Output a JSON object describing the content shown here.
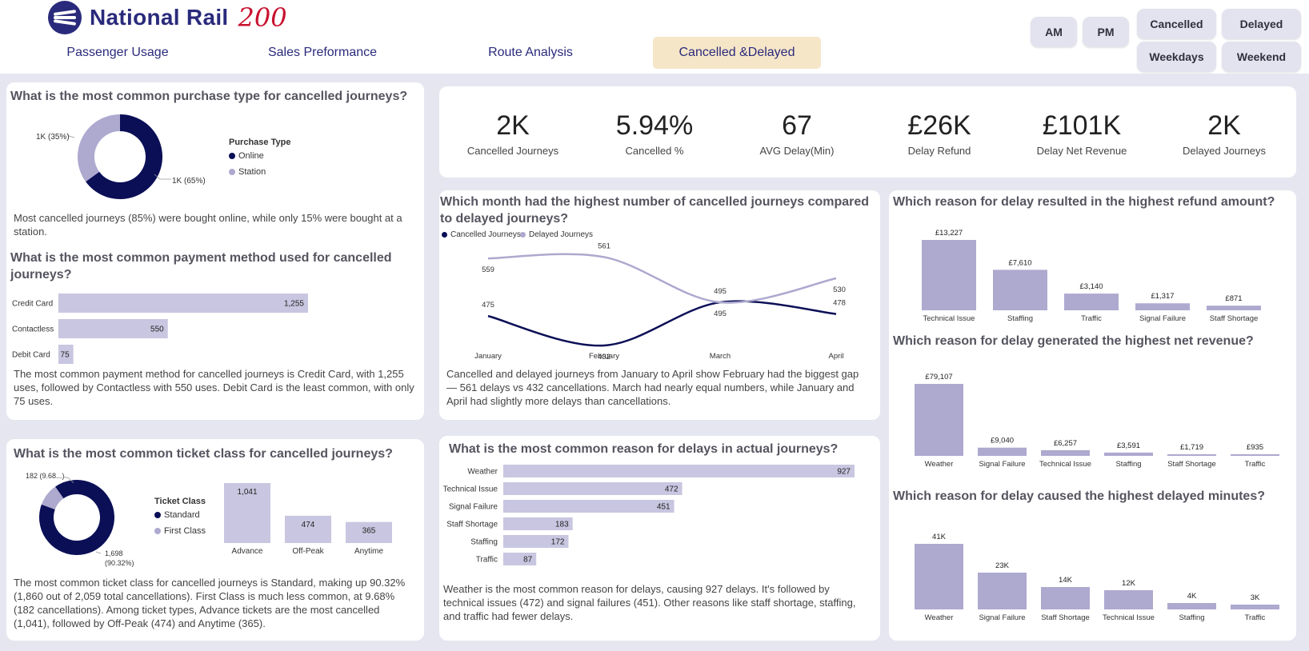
{
  "colors": {
    "navy": "#0a0f56",
    "lavender": "#ada9cf",
    "bar": "#c8c6e0",
    "active_tab": "#f6e6c8"
  },
  "brand": {
    "name": "National Rail",
    "badge": "200"
  },
  "nav": {
    "tabs": [
      "Passenger Usage",
      "Sales Preformance",
      "Route Analysis",
      "Cancelled &Delayed"
    ],
    "active": "Cancelled &Delayed"
  },
  "slicers": {
    "am": "AM",
    "pm": "PM",
    "cancelled": "Cancelled",
    "delayed": "Delayed",
    "weekdays": "Weekdays",
    "weekend": "Weekend"
  },
  "kpis": [
    {
      "value": "2K",
      "label": "Cancelled Journeys"
    },
    {
      "value": "5.94%",
      "label": "Cancelled %"
    },
    {
      "value": "67",
      "label": "AVG Delay(Min)"
    },
    {
      "value": "£26K",
      "label": "Delay Refund"
    },
    {
      "value": "£101K",
      "label": "Delay Net Revenue"
    },
    {
      "value": "2K",
      "label": "Delayed Journeys"
    }
  ],
  "purchase": {
    "question": "What is the most common purchase type for cancelled journeys?",
    "legend_title": "Purchase Type",
    "legend": [
      "Online",
      "Station"
    ],
    "label_online": "1K (65%)",
    "label_station": "1K (35%)",
    "text": "Most cancelled journeys (85%) were bought online, while only 15% were bought at a station."
  },
  "payment": {
    "question": "What is the most common payment method used for cancelled journeys?",
    "text": "The most common payment method for cancelled journeys is Credit Card, with 1,255 uses, followed by Contactless with 550 uses. Debit Card is the least common, with only 75 uses."
  },
  "ticket": {
    "question": "What is the most common ticket class for cancelled journeys?",
    "legend_title": "Ticket Class",
    "legend": [
      "Standard",
      "First Class"
    ],
    "label_first": "182 (9.68...)",
    "label_standard_1": "1,698",
    "label_standard_2": "(90.32%)",
    "text": "The most common ticket class for cancelled journeys is Standard, making up 90.32% (1,860 out of 2,059 total cancellations). First Class is much less common, at 9.68% (182 cancellations). Among ticket types, Advance tickets are the most cancelled (1,041), followed by Off-Peak (474) and Anytime (365)."
  },
  "month": {
    "question": "Which month had the highest number of cancelled journeys compared to delayed journeys?",
    "text": "Cancelled and delayed journeys from January to April show February had the biggest gap — 561 delays vs 432 cancellations. March had nearly equal numbers, while January and April had slightly more delays than cancellations."
  },
  "reasons": {
    "question": "What is the most common reason for delays in actual journeys?",
    "text": "Weather is the most common reason for delays, causing 927 delays. It's followed by technical issues (472) and signal failures (451). Other reasons like staff shortage, staffing, and traffic had fewer delays."
  },
  "refund": {
    "question": "Which reason for delay resulted in the highest refund amount?"
  },
  "revenue": {
    "question": "Which reason for delay generated the highest net revenue?"
  },
  "minutes": {
    "question": "Which reason for delay caused the highest delayed minutes?"
  },
  "chart_data": [
    {
      "id": "purchase",
      "type": "pie",
      "categories": [
        "Online",
        "Station"
      ],
      "values": [
        65,
        35
      ],
      "labels": [
        "1K (65%)",
        "1K (35%)"
      ]
    },
    {
      "id": "payment",
      "type": "bar",
      "orientation": "horizontal",
      "categories": [
        "Credit Card",
        "Contactless",
        "Debit Card"
      ],
      "values": [
        1255,
        550,
        75
      ],
      "labels": [
        "1,255",
        "550",
        "75"
      ]
    },
    {
      "id": "ticket_class",
      "type": "pie",
      "categories": [
        "Standard",
        "First Class"
      ],
      "values": [
        90.32,
        9.68
      ]
    },
    {
      "id": "ticket_type",
      "type": "bar",
      "categories": [
        "Advance",
        "Off-Peak",
        "Anytime"
      ],
      "values": [
        1041,
        474,
        365
      ],
      "labels": [
        "1,041",
        "474",
        "365"
      ]
    },
    {
      "id": "month",
      "type": "line",
      "x": [
        "January",
        "February",
        "March",
        "April"
      ],
      "legend": [
        "Cancelled Journeys",
        "Delayed Journeys"
      ],
      "series": [
        {
          "name": "Cancelled Journeys",
          "values": [
            475,
            432,
            495,
            478
          ]
        },
        {
          "name": "Delayed Journeys",
          "values": [
            559,
            561,
            495,
            530
          ]
        }
      ]
    },
    {
      "id": "reasons",
      "type": "bar",
      "orientation": "horizontal",
      "categories": [
        "Weather",
        "Technical Issue",
        "Signal Failure",
        "Staff Shortage",
        "Staffing",
        "Traffic"
      ],
      "values": [
        927,
        472,
        451,
        183,
        172,
        87
      ]
    },
    {
      "id": "refund",
      "type": "bar",
      "categories": [
        "Technical Issue",
        "Staffing",
        "Traffic",
        "Signal Failure",
        "Staff Shortage"
      ],
      "values": [
        13227,
        7610,
        3140,
        1317,
        871
      ],
      "labels": [
        "£13,227",
        "£7,610",
        "£3,140",
        "£1,317",
        "£871"
      ]
    },
    {
      "id": "revenue",
      "type": "bar",
      "categories": [
        "Weather",
        "Signal Failure",
        "Technical Issue",
        "Staffing",
        "Staff Shortage",
        "Traffic"
      ],
      "values": [
        79107,
        9040,
        6257,
        3591,
        1719,
        935
      ],
      "labels": [
        "£79,107",
        "£9,040",
        "£6,257",
        "£3,591",
        "£1,719",
        "£935"
      ]
    },
    {
      "id": "minutes",
      "type": "bar",
      "categories": [
        "Weather",
        "Signal Failure",
        "Staff Shortage",
        "Technical Issue",
        "Staffing",
        "Traffic"
      ],
      "values": [
        41,
        23,
        14,
        12,
        4,
        3
      ],
      "labels": [
        "41K",
        "23K",
        "14K",
        "12K",
        "4K",
        "3K"
      ]
    }
  ]
}
